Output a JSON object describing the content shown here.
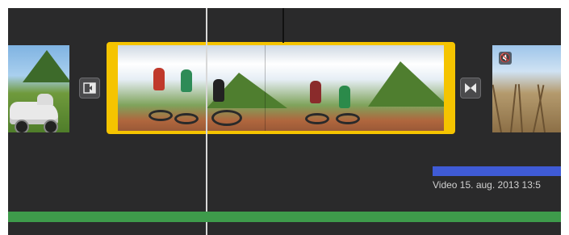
{
  "timeline": {
    "clips": [
      {
        "name": "left-clip",
        "muted": false
      },
      {
        "name": "selected-clip",
        "selected": true
      },
      {
        "name": "right-clip",
        "muted": true
      }
    ],
    "transitions": [
      {
        "icon": "cross-dissolve-icon"
      },
      {
        "icon": "bowtie-transition-icon"
      }
    ],
    "audio_clip": {
      "label": "Video 15. aug. 2013 13:5",
      "color": "#3f5bd6"
    },
    "music_track": {
      "color": "#3e9b4b"
    },
    "selection_color": "#f5c400",
    "mute_icon": "speaker-mute-icon"
  }
}
